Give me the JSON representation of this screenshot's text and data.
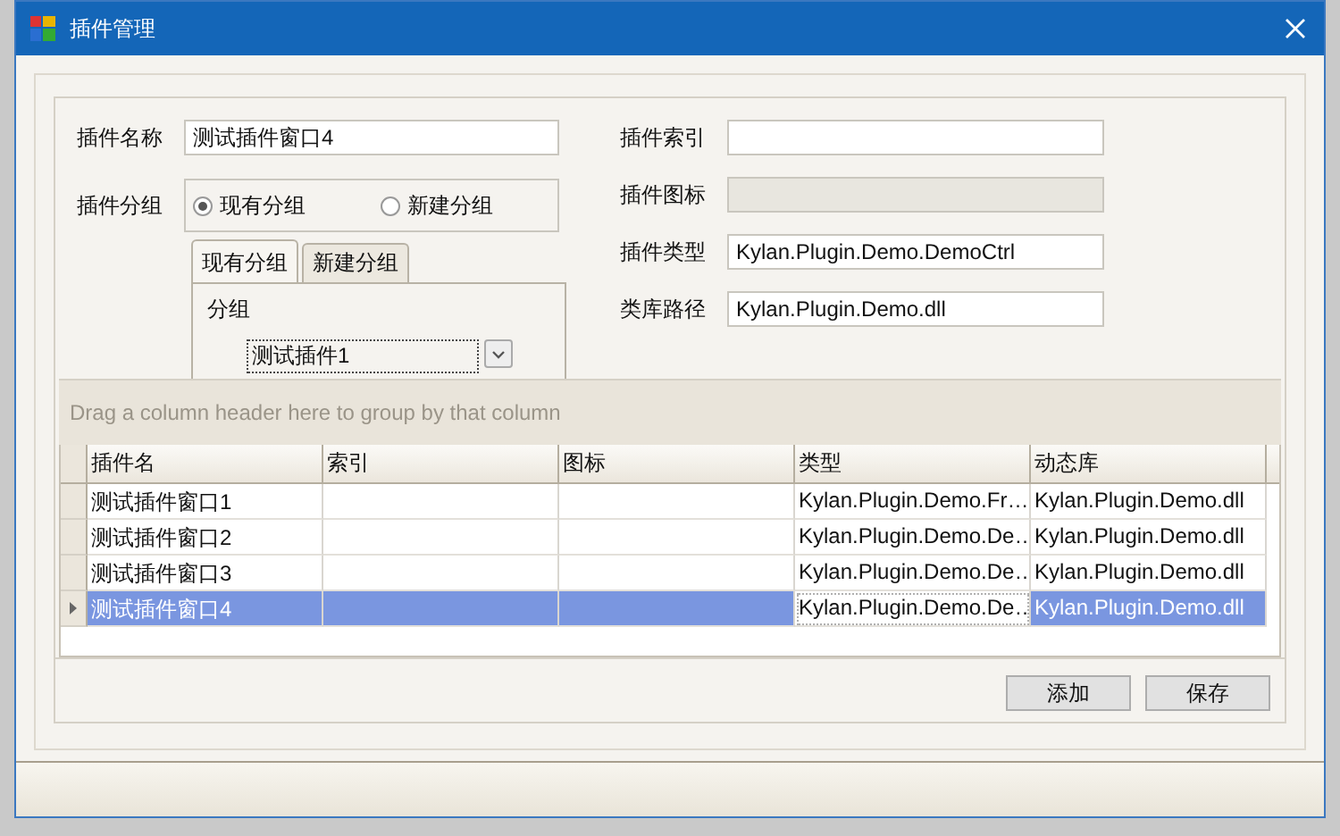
{
  "window": {
    "title": "插件管理"
  },
  "form": {
    "name": {
      "label": "插件名称",
      "value": "测试插件窗口4"
    },
    "group": {
      "label": "插件分组",
      "options": [
        {
          "label": "现有分组",
          "selected": true
        },
        {
          "label": "新建分组",
          "selected": false
        }
      ]
    },
    "tabs": [
      {
        "label": "现有分组",
        "selected": true
      },
      {
        "label": "新建分组",
        "selected": false
      }
    ],
    "group_box": {
      "title": "分组",
      "combo_value": "测试插件1"
    },
    "index": {
      "label": "插件索引"
    },
    "icon": {
      "label": "插件图标",
      "disabled": true
    },
    "type": {
      "label": "插件类型",
      "value": "Kylan.Plugin.Demo.DemoCtrl"
    },
    "path": {
      "label": "类库路径",
      "value": "Kylan.Plugin.Demo.dll"
    }
  },
  "grid": {
    "group_panel_hint": "Drag a column header here to group by that column",
    "columns": [
      "插件名",
      "索引",
      "图标",
      "类型",
      "动态库"
    ],
    "rows": [
      {
        "name": "测试插件窗口1",
        "type": "Kylan.Plugin.Demo.Fr…",
        "library": "Kylan.Plugin.Demo.dll",
        "selected": false,
        "type_cell_focused": false
      },
      {
        "name": "测试插件窗口2",
        "type": "Kylan.Plugin.Demo.De…",
        "library": "Kylan.Plugin.Demo.dll",
        "selected": false,
        "type_cell_focused": false
      },
      {
        "name": "测试插件窗口3",
        "type": "Kylan.Plugin.Demo.De…",
        "library": "Kylan.Plugin.Demo.dll",
        "selected": false,
        "type_cell_focused": false
      },
      {
        "name": "测试插件窗口4",
        "type": "Kylan.Plugin.Demo.De…",
        "library": "Kylan.Plugin.Demo.dll",
        "selected": true,
        "type_cell_focused": true
      }
    ]
  },
  "buttons": [
    "添加",
    "保存"
  ]
}
